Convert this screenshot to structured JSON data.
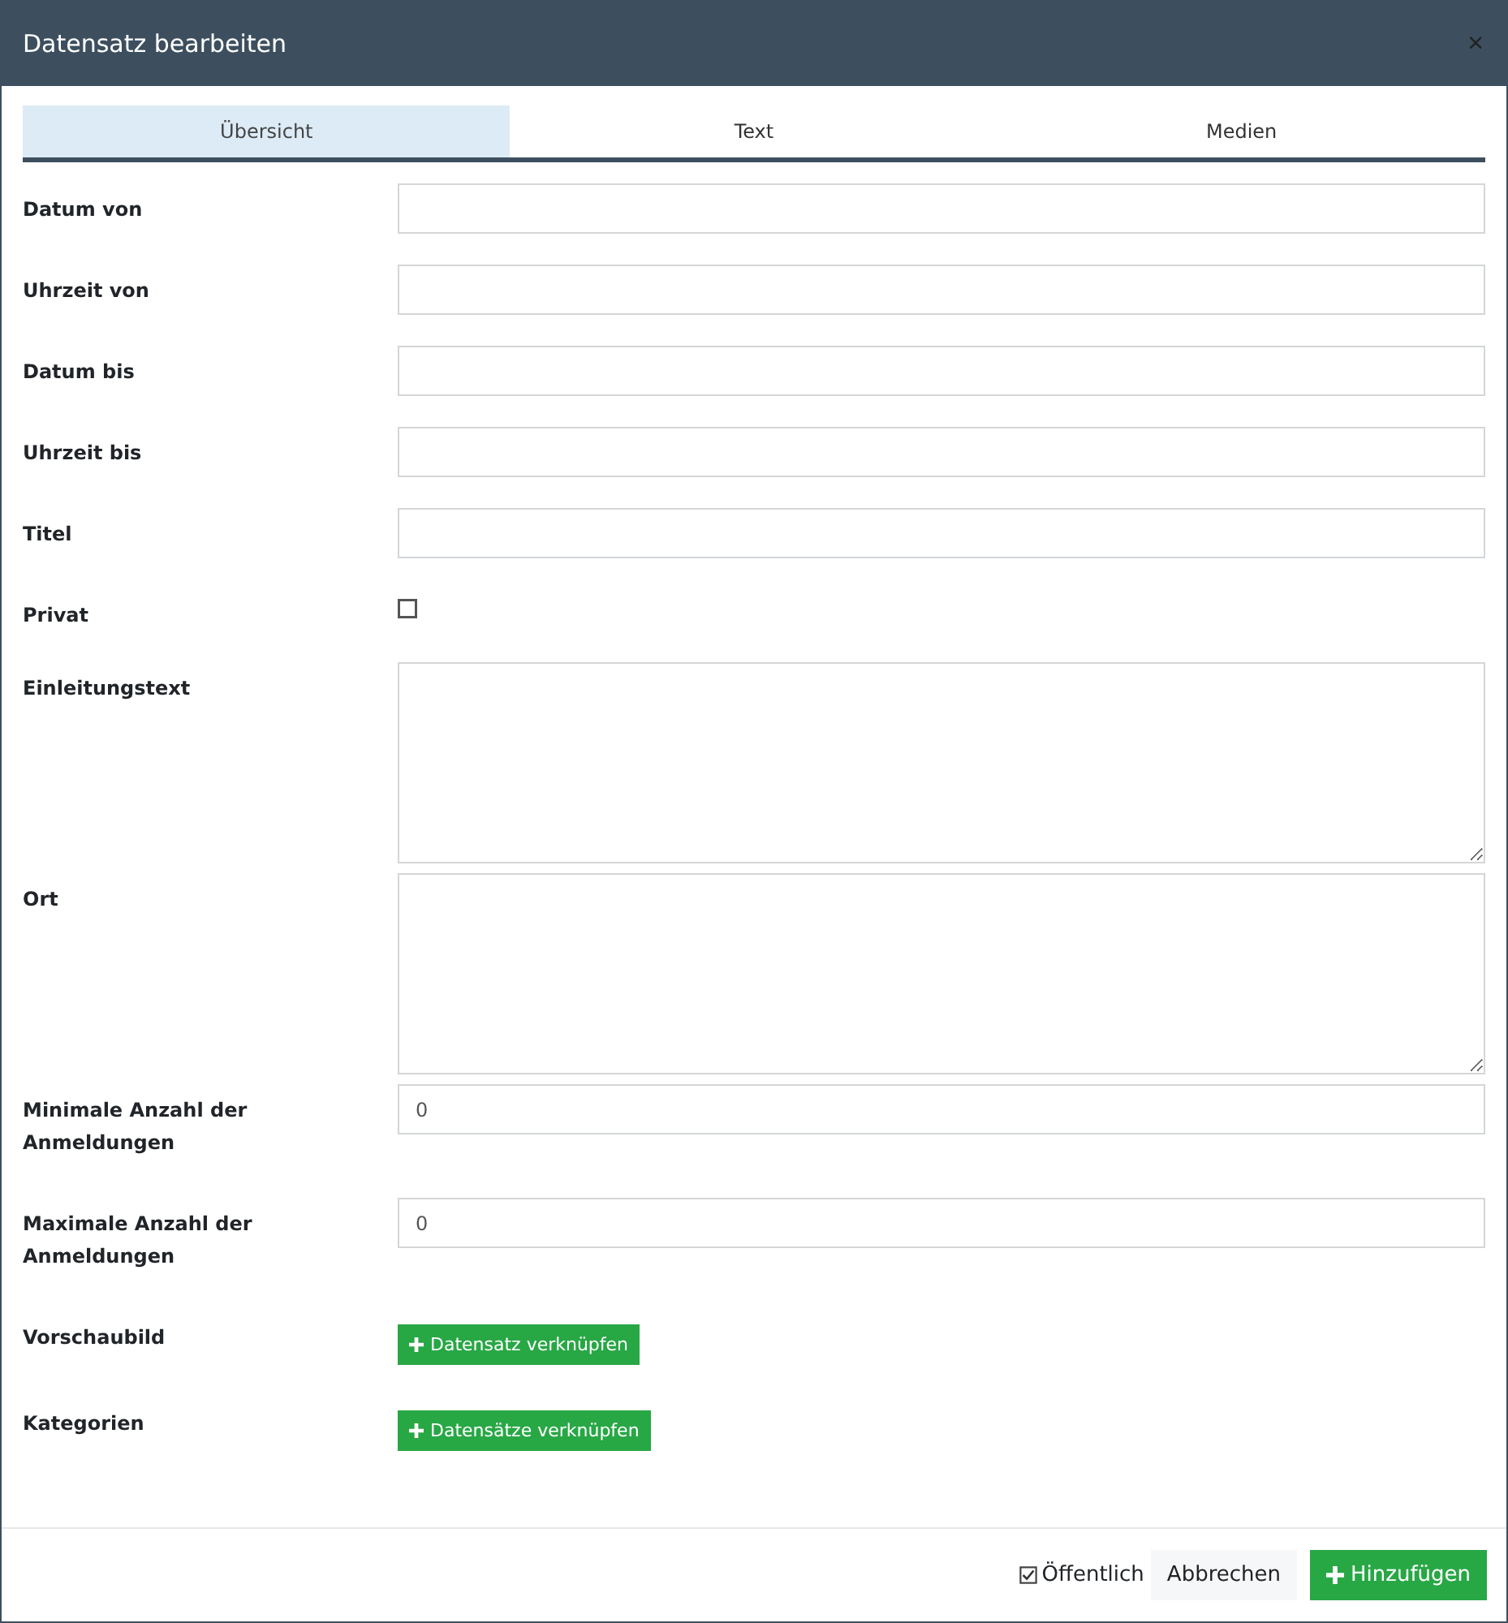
{
  "dialog": {
    "title": "Datensatz bearbeiten",
    "close": "×"
  },
  "tabs": [
    {
      "label": "Übersicht",
      "selected": true
    },
    {
      "label": "Text",
      "selected": false
    },
    {
      "label": "Medien",
      "selected": false
    }
  ],
  "fields": [
    {
      "kind": "text",
      "label": "Datum von"
    },
    {
      "kind": "text",
      "label": "Uhrzeit von"
    },
    {
      "kind": "text",
      "label": "Datum bis"
    },
    {
      "kind": "text",
      "label": "Uhrzeit bis"
    },
    {
      "kind": "text",
      "label": "Titel"
    },
    {
      "kind": "checkbox",
      "label": "Privat",
      "checked": false
    },
    {
      "kind": "textarea",
      "label": "Einleitungstext"
    },
    {
      "kind": "textarea",
      "label": "Ort"
    },
    {
      "kind": "text",
      "label": "Minimale Anzahl der Anmeldungen",
      "value": "0"
    },
    {
      "kind": "text",
      "label": "Maximale Anzahl der Anmeldungen",
      "value": "0"
    },
    {
      "kind": "link",
      "label": "Vorschaubild",
      "button": "Datensatz verknüpfen"
    },
    {
      "kind": "link",
      "label": "Kategorien",
      "button": "Datensätze verknüpfen"
    }
  ],
  "footer": {
    "public": {
      "label": "Öffentlich",
      "checked": true
    },
    "cancel": "Abbrechen",
    "submit": "Hinzufügen"
  }
}
